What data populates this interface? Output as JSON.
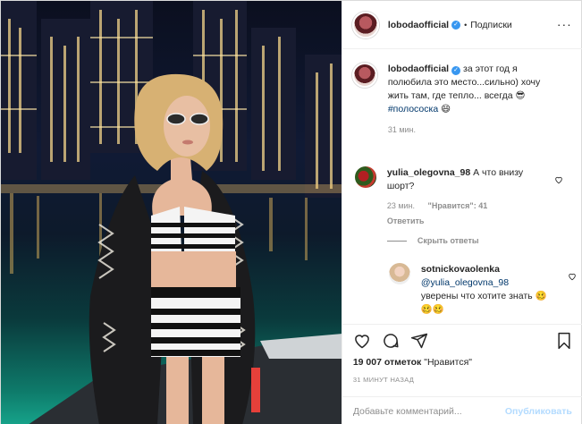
{
  "header": {
    "username": "lobodaofficial",
    "separator": "•",
    "follow_label": "Подписки"
  },
  "caption": {
    "username": "lobodaofficial",
    "text": "за этот год я полюбила это место...сильно) хочу жить там, где тепло... всегда 😎",
    "hashtag": "#полососка",
    "hashtag_emoji": "😄",
    "time": "31 мин."
  },
  "comments": [
    {
      "username": "yulia_olegovna_98",
      "text": "А что внизу шорт?",
      "time": "23 мин.",
      "likes": "\"Нравится\": 41",
      "reply_label": "Ответить"
    }
  ],
  "replies_toggle": "Скрыть ответы",
  "reply": {
    "username": "sotnickovaolenka",
    "mention": "@yulia_olegovna_98",
    "text": "уверены что хотите знать 🥴🥴🥴"
  },
  "actions": {
    "likes_count": "19 007 отметок",
    "likes_label": "\"Нравится\"",
    "posted": "31 МИНУТ НАЗАД"
  },
  "add_comment": {
    "placeholder": "Добавьте комментарий...",
    "publish": "Опубликовать"
  },
  "colors": {
    "verified": "#3897f0",
    "link": "#00376b",
    "muted": "#8e8e8e",
    "publish_disabled": "#b3dbff"
  }
}
